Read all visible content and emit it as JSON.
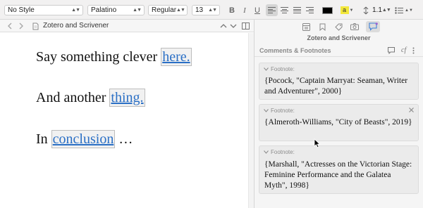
{
  "format_bar": {
    "style": "No Style",
    "font_family": "Palatino",
    "font_weight": "Regular",
    "font_size": "13",
    "bold_label": "B",
    "italic_label": "I",
    "underline_label": "U",
    "text_color": "#000000",
    "highlight_label": "a",
    "highlight_color": "#f3e83b",
    "line_spacing": "1.1",
    "list_icon": "list-icon"
  },
  "editor": {
    "title": "Zotero and Scrivener",
    "paragraphs": [
      {
        "before": "Say something clever ",
        "anchor": "here.",
        "after": ""
      },
      {
        "before": "And another ",
        "anchor": "thing.",
        "after": ""
      },
      {
        "before": "In ",
        "anchor": "conclusion",
        "after": " …"
      }
    ]
  },
  "inspector": {
    "title": "Zotero and Scrivener",
    "section": "Comments & Footnotes",
    "footnote_tool": "cf",
    "footnotes": [
      {
        "label": "Footnote:",
        "text": "{Pocock, \"Captain Marryat: Seaman, Writer and Adventurer\", 2000}"
      },
      {
        "label": "Footnote:",
        "text": "{Almeroth-Williams, \"City of Beasts\", 2019}"
      },
      {
        "label": "Footnote:",
        "text": "{Marshall, \"Actresses on the Victorian Stage: Feminine Performance and the Galatea Myth\", 1998}"
      }
    ]
  }
}
